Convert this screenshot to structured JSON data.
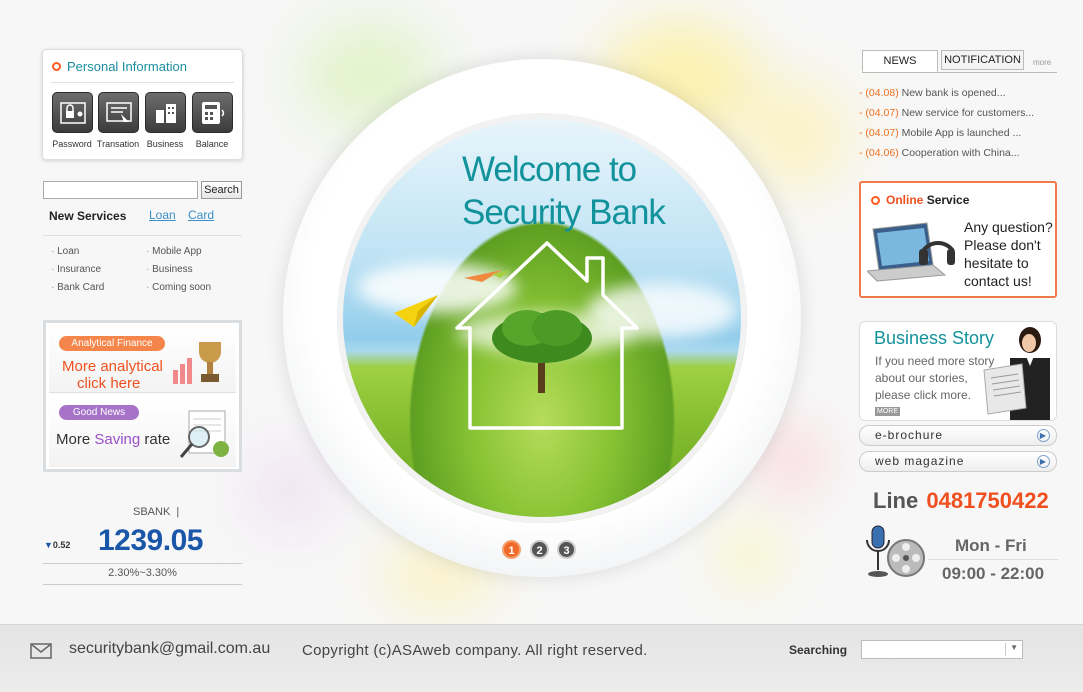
{
  "personal": {
    "title": "Personal Information",
    "items": [
      {
        "label": "Password",
        "icon": "password-icon"
      },
      {
        "label": "Transation",
        "icon": "transaction-icon"
      },
      {
        "label": "Business",
        "icon": "business-icon"
      },
      {
        "label": "Balance",
        "icon": "calculator-icon"
      }
    ]
  },
  "search": {
    "placeholder": "",
    "button": "Search"
  },
  "new_services": {
    "title": "New Services",
    "links": [
      "Loan",
      "Card"
    ],
    "col1": [
      "Loan",
      "Insurance",
      "Bank Card"
    ],
    "col2": [
      "Mobile App",
      "Business",
      "Coming soon"
    ]
  },
  "ads": {
    "analytical": {
      "pill": "Analytical Finance",
      "line1": "More analytical",
      "line2": "click here"
    },
    "good_news": {
      "pill": "Good News",
      "prefix": "More",
      "highlight": "Saving",
      "suffix": "rate"
    }
  },
  "stock": {
    "name": "SBANK",
    "sep": "|",
    "change": "0.52",
    "value": "1239.05",
    "range": "2.30%~3.30%"
  },
  "hero": {
    "line1": "Welcome to",
    "line2": "Security Bank",
    "dots": [
      "1",
      "2",
      "3"
    ]
  },
  "news": {
    "tabs": [
      "NEWS",
      "NOTIFICATION"
    ],
    "more": "more",
    "items": [
      {
        "date": "(04.08)",
        "text": "New bank is  opened..."
      },
      {
        "date": "(04.07)",
        "text": "New service for customers..."
      },
      {
        "date": "(04.07)",
        "text": "Mobile App is launched ..."
      },
      {
        "date": "(04.06)",
        "text": "Cooperation with China..."
      }
    ]
  },
  "online": {
    "title_highlight": "Online",
    "title_rest": "Service",
    "lines": [
      "Any question?",
      "Please don't",
      "hesitate to",
      "contact us!"
    ]
  },
  "business_story": {
    "title": "Business Story",
    "lines": [
      "If you need more story",
      "about our stories,",
      "please click more."
    ],
    "more": "MORE"
  },
  "links": [
    "e-brochure",
    "web magazine"
  ],
  "line": {
    "label": "Line",
    "number": "0481750422",
    "days": "Mon - Fri",
    "hours": "09:00 - 22:00"
  },
  "footer": {
    "email": "securitybank@gmail.com.au",
    "copyright": "Copyright (c)ASAweb company. All right reserved.",
    "searching": "Searching"
  },
  "colors": {
    "accent": "#12929b",
    "orange": "#f0501f",
    "stock_blue": "#1a57a8"
  }
}
